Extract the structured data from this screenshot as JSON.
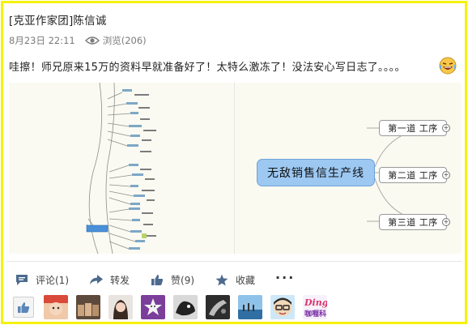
{
  "post": {
    "title": "[克亚作家团]陈信诚",
    "date": "8月23日 22:11",
    "views": "浏览(206)",
    "text": "哇擦！师兄原来15万的资料早就准备好了！太特么激冻了！没法安心写日志了。。。。"
  },
  "mindmap": {
    "center": "无敌销售信生产线",
    "nodes": [
      "第一道 工序",
      "第二道 工序",
      "第三道 工序"
    ]
  },
  "actions": {
    "comment": "评论(1)",
    "share": "转发",
    "like": "赞(9)",
    "favorite": "收藏",
    "more": "···"
  },
  "likers": {
    "last_name_text": "咖喱科"
  }
}
